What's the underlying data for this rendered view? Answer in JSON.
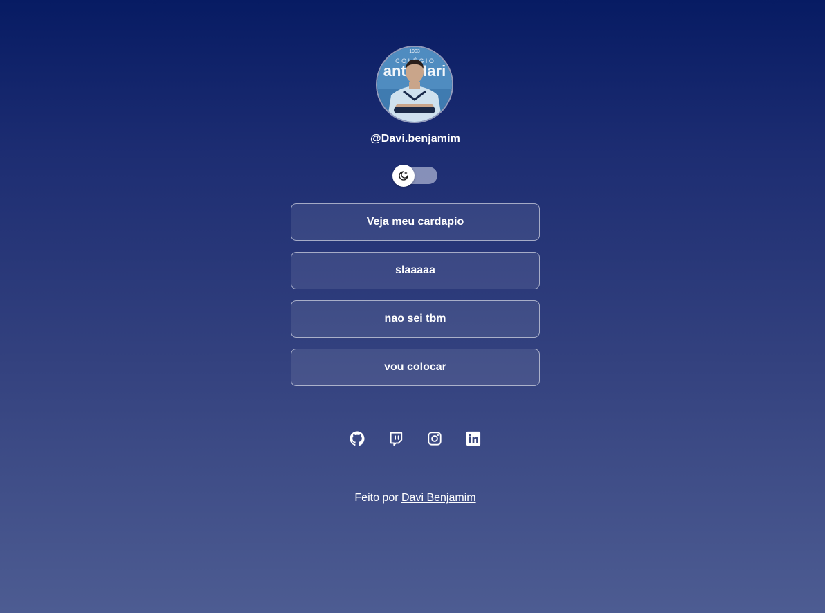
{
  "profile": {
    "handle": "@Davi.benjamim",
    "avatar_badge_year": "1903",
    "avatar_banner_text": "C O L É G I O",
    "avatar_banner_name": "antaMari"
  },
  "theme_toggle": {
    "icon": "moon-star-icon",
    "state": "dark"
  },
  "links": [
    {
      "label": "Veja meu cardapio"
    },
    {
      "label": "slaaaaa"
    },
    {
      "label": "nao sei tbm"
    },
    {
      "label": "vou colocar"
    }
  ],
  "social": [
    {
      "icon": "github-icon"
    },
    {
      "icon": "twitch-icon"
    },
    {
      "icon": "instagram-icon"
    },
    {
      "icon": "linkedin-icon"
    }
  ],
  "footer": {
    "prefix": "Feito por",
    "author_link": "Davi Benjamim"
  },
  "colors": {
    "background_top": "#071b63",
    "background_bottom": "#4d5c92",
    "button_border": "#ffffff"
  }
}
